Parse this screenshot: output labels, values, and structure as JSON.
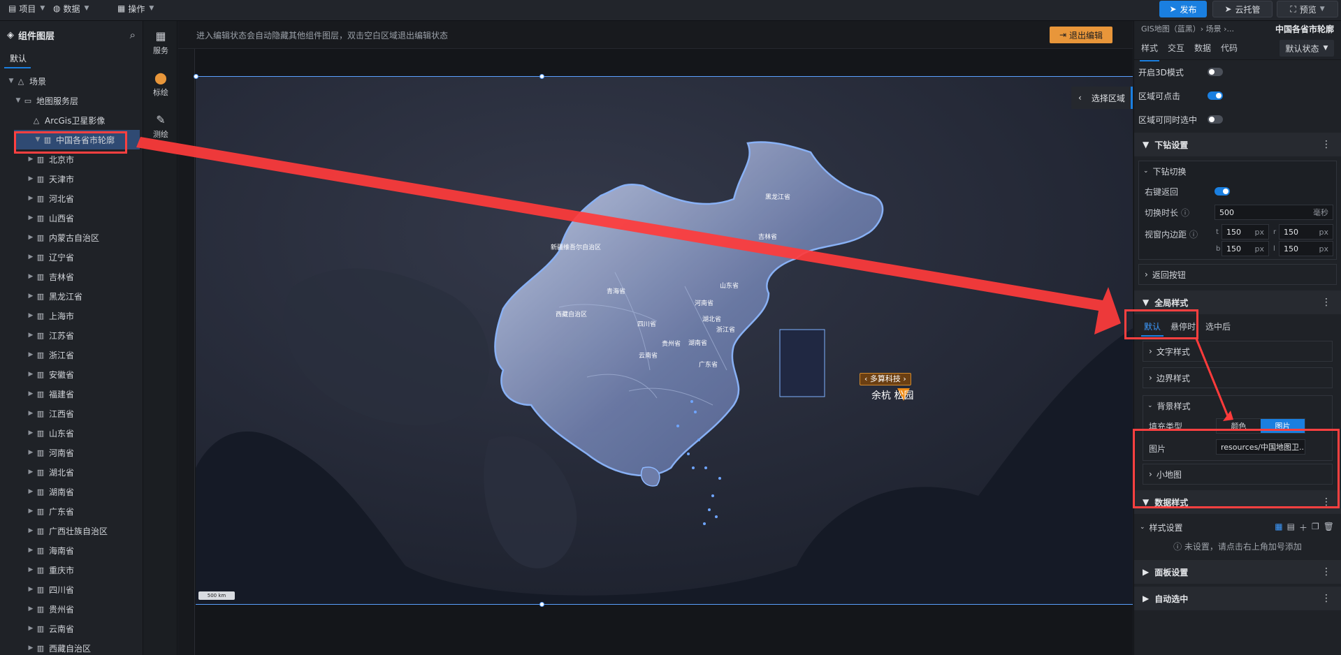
{
  "topbar": {
    "menus": [
      {
        "icon": "file-icon",
        "label": "项目"
      },
      {
        "icon": "database-icon",
        "label": "数据"
      },
      {
        "icon": "grid-icon",
        "label": "操作"
      }
    ],
    "publish_label": "发布",
    "cloud_label": "云托管",
    "preview_label": "预览"
  },
  "layers": {
    "title": "组件图层",
    "tab": "默认",
    "scene": "场景",
    "map_service_layer": "地图服务层",
    "arcgis": "ArcGis卫星影像",
    "selected": "中国各省市轮廓",
    "provinces": [
      "北京市",
      "天津市",
      "河北省",
      "山西省",
      "内蒙古自治区",
      "辽宁省",
      "吉林省",
      "黑龙江省",
      "上海市",
      "江苏省",
      "浙江省",
      "安徽省",
      "福建省",
      "江西省",
      "山东省",
      "河南省",
      "湖北省",
      "湖南省",
      "广东省",
      "广西壮族自治区",
      "海南省",
      "重庆市",
      "四川省",
      "贵州省",
      "云南省",
      "西藏自治区"
    ]
  },
  "tools": [
    {
      "icon": "map-icon",
      "label": "服务"
    },
    {
      "icon": "pin-icon",
      "label": "标绘"
    },
    {
      "icon": "ruler-icon",
      "label": "测绘"
    }
  ],
  "canvas": {
    "hint": "进入编辑状态会自动隐藏其他组件图层，双击空白区域退出编辑状态",
    "exit_label": "退出编辑",
    "region_button": "选择区域",
    "scale": "500 km",
    "poi_tag": "多算科技",
    "poi_label": "余杭     松园",
    "map_labels": [
      "黑龙江省",
      "吉林省",
      "新疆维吾尔自治区",
      "青海省",
      "西藏自治区",
      "四川省",
      "山东省",
      "河南省",
      "湖北省",
      "浙江省",
      "湖南省",
      "贵州省",
      "云南省",
      "广东省"
    ]
  },
  "props": {
    "breadcrumb": "GIS地图（蓝黑）› 场景 ›...",
    "title": "中国各省市轮廓",
    "tabs": [
      "样式",
      "交互",
      "数据",
      "代码"
    ],
    "state": "默认状态",
    "toggle_3d": "开启3D模式",
    "clickable": "区域可点击",
    "multi_select": "区域可同时选中",
    "drill_section": "下钻设置",
    "drill_switch": "下钻切换",
    "right_back": "右键返回",
    "switch_duration": "切换时长",
    "duration_value": "500",
    "duration_unit": "毫秒",
    "viewport_padding": "视窗内边距",
    "pad_t": "150",
    "pad_r": "150",
    "pad_b": "150",
    "pad_l": "150",
    "pad_unit": "px",
    "back_button": "返回按钮",
    "global_style": "全局样式",
    "gs_tabs": [
      "默认",
      "悬停时",
      "选中后"
    ],
    "text_style": "文字样式",
    "border_style": "边界样式",
    "bg_style": "背景样式",
    "fill_type": "填充类型",
    "fill_color": "颜色",
    "fill_image": "图片",
    "image_label": "图片",
    "image_value": "resources/中国地图卫...",
    "minimap": "小地图",
    "data_style": "数据样式",
    "style_settings": "样式设置",
    "empty_tip": "未设置，请点击右上角加号添加",
    "panel_settings": "面板设置",
    "auto_select": "自动选中"
  },
  "colors": {
    "accent": "#1a7fe0",
    "highlight": "#ff4040",
    "warning": "#e8963a"
  }
}
